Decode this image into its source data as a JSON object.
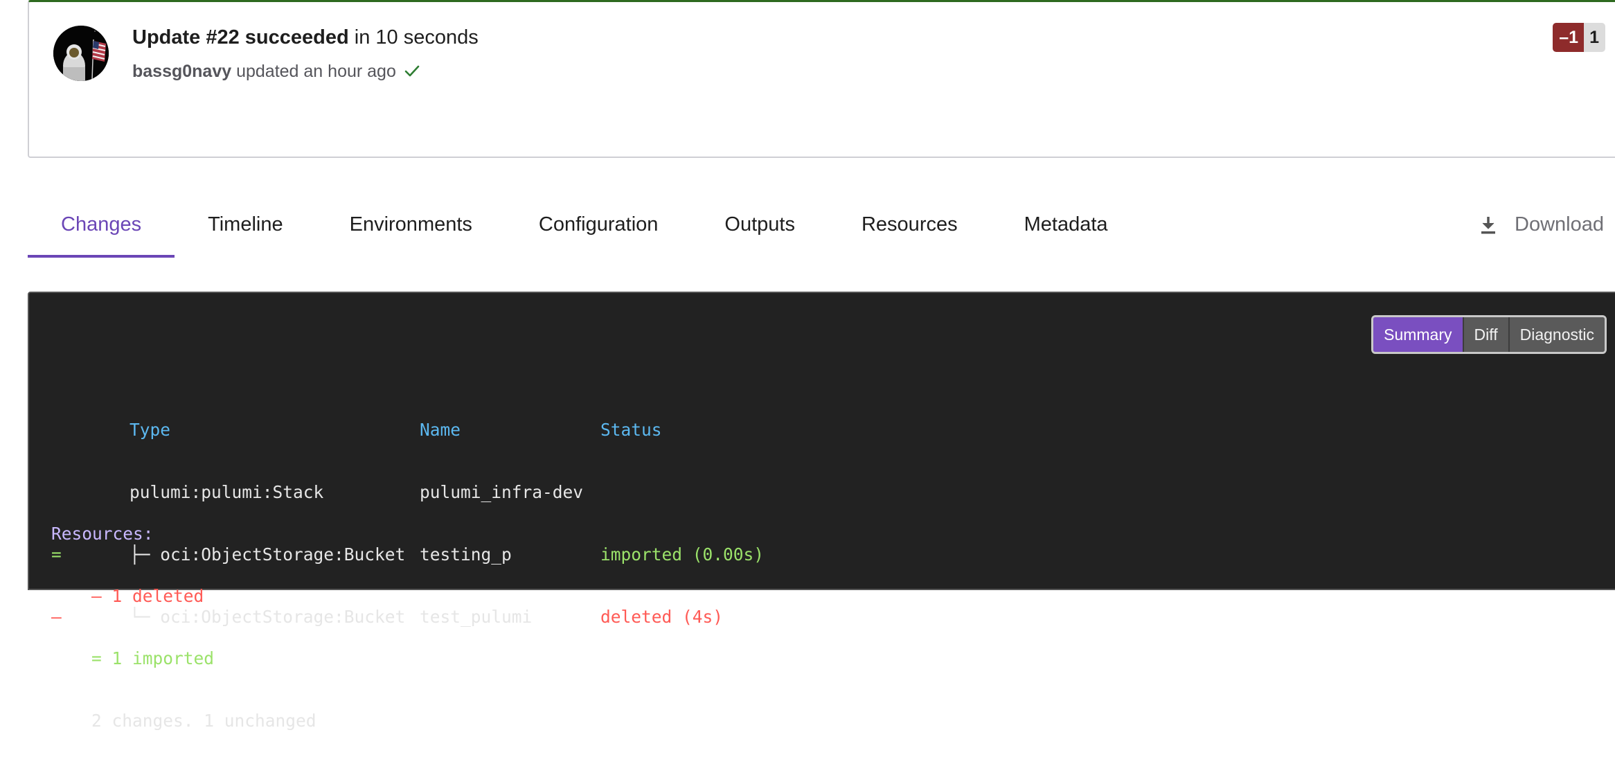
{
  "update": {
    "title_strong": "Update #22 succeeded",
    "title_rest": " in 10 seconds",
    "user": "bassg0navy",
    "time_text": "updated an hour ago",
    "avatar_icon": "astronaut-flag-avatar",
    "status_icon": "check-icon",
    "status_color": "#2e7d32",
    "badges": {
      "delete": "–1",
      "unchanged": "1",
      "delete_color": "#8e2b2b",
      "unchanged_color": "#dcdcdc"
    }
  },
  "tabs": [
    {
      "label": "Changes",
      "active": true
    },
    {
      "label": "Timeline",
      "active": false
    },
    {
      "label": "Environments",
      "active": false
    },
    {
      "label": "Configuration",
      "active": false
    },
    {
      "label": "Outputs",
      "active": false
    },
    {
      "label": "Resources",
      "active": false
    },
    {
      "label": "Metadata",
      "active": false
    }
  ],
  "download": {
    "label": "Download",
    "icon": "download-icon"
  },
  "view_toggle": {
    "options": [
      "Summary",
      "Diff",
      "Diagnostic"
    ],
    "selected": "Summary",
    "accent": "#7a4fc0"
  },
  "console": {
    "headers": {
      "type": "Type",
      "name": "Name",
      "status": "Status"
    },
    "rows": [
      {
        "op": "",
        "type": "pulumi:pulumi:Stack",
        "name": "pulumi_infra-dev",
        "status": ""
      },
      {
        "op": "=",
        "type": "├─ oci:ObjectStorage:Bucket",
        "name": "testing_p",
        "status": "imported (0.00s)"
      },
      {
        "op": "–",
        "type": "└─ oci:ObjectStorage:Bucket",
        "name": "test_pulumi",
        "status": "deleted (4s)"
      }
    ],
    "resources_label": "Resources:",
    "resources_lines": {
      "deleted": "– 1 deleted",
      "imported": "= 1 imported",
      "summary": "2 changes. 1 unchanged"
    }
  }
}
